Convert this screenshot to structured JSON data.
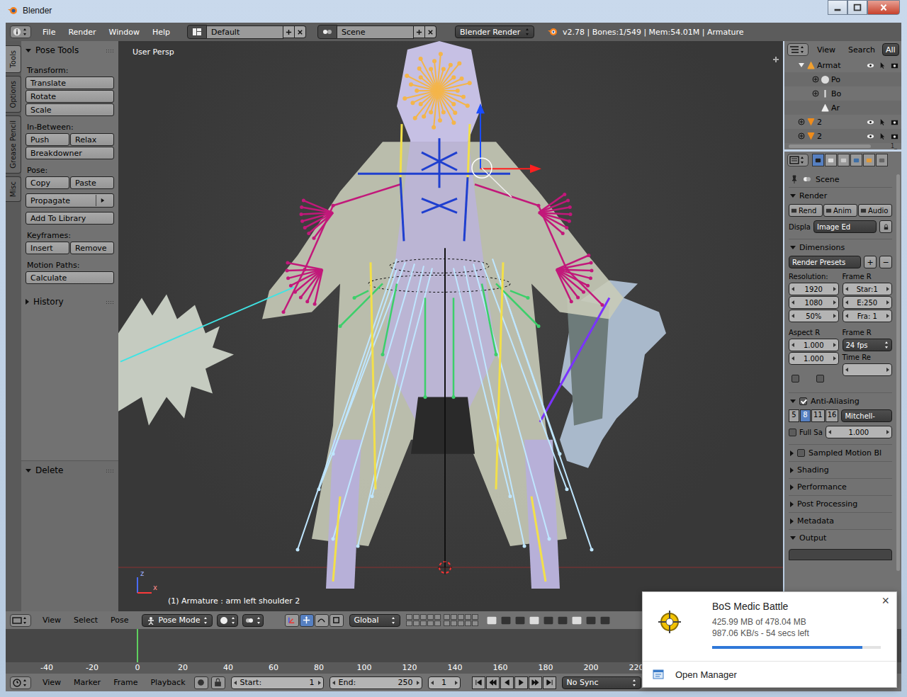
{
  "window": {
    "title": "Blender"
  },
  "info_header": {
    "menus": [
      "File",
      "Render",
      "Window",
      "Help"
    ],
    "layout": "Default",
    "scene": "Scene",
    "engine": "Blender Render",
    "stats": "v2.78 | Bones:1/549 | Mem:54.01M | Armature"
  },
  "tool_shelf": {
    "tabs": [
      {
        "label": "Tools",
        "selected": true
      },
      {
        "label": "Options",
        "selected": false
      },
      {
        "label": "Grease Pencil",
        "selected": false
      },
      {
        "label": "Misc",
        "selected": false
      }
    ],
    "panel": {
      "title": "Pose Tools",
      "expanded": true,
      "groups": [
        {
          "label": "Transform:",
          "joined": true,
          "rows": [
            [
              {
                "label": "Translate",
                "kind": "button"
              }
            ],
            [
              {
                "label": "Rotate",
                "kind": "button"
              }
            ],
            [
              {
                "label": "Scale",
                "kind": "button"
              }
            ]
          ]
        },
        {
          "label": "In-Between:",
          "joined": true,
          "rows": [
            [
              {
                "label": "Push",
                "kind": "button"
              },
              {
                "label": "Relax",
                "kind": "button"
              }
            ],
            [
              {
                "label": "Breakdowner",
                "kind": "button"
              }
            ]
          ]
        },
        {
          "label": "Pose:",
          "joined": false,
          "rows": [
            [
              {
                "label": "Copy",
                "kind": "button"
              },
              {
                "label": "Paste",
                "kind": "button"
              }
            ],
            [
              {
                "label": "Propagate",
                "kind": "menu"
              }
            ],
            [
              {
                "label": "Add To Library",
                "kind": "button"
              }
            ]
          ]
        },
        {
          "label": "Keyframes:",
          "joined": true,
          "rows": [
            [
              {
                "label": "Insert",
                "kind": "button"
              },
              {
                "label": "Remove",
                "kind": "button"
              }
            ]
          ]
        },
        {
          "label": "Motion Paths:",
          "joined": true,
          "rows": [
            [
              {
                "label": "Calculate",
                "kind": "button"
              }
            ]
          ]
        }
      ]
    },
    "history": {
      "title": "History",
      "expanded": false
    },
    "operator_panel": {
      "title": "Delete",
      "expanded": true
    }
  },
  "viewport": {
    "view_label": "User Persp",
    "status": "(1) Armature : arm left shoulder 2",
    "axes": [
      "z",
      "x"
    ]
  },
  "viewport_header": {
    "menus": [
      "View",
      "Select",
      "Pose"
    ],
    "mode": "Pose Mode",
    "orientation": "Global",
    "manipulators": [
      {
        "selected": false
      },
      {
        "selected": true
      },
      {
        "selected": false
      },
      {
        "selected": false
      }
    ]
  },
  "outliner": {
    "menus": [
      "View",
      "Search"
    ],
    "filter": "All",
    "corner_text": "1_",
    "rows": [
      {
        "label": "Armat",
        "depth": 0,
        "kind": "armature",
        "toggle": true,
        "expanded": true
      },
      {
        "label": "Po",
        "depth": 1,
        "kind": "pose",
        "toggle": true,
        "expanded": false
      },
      {
        "label": "Bo",
        "depth": 1,
        "kind": "bones",
        "toggle": true,
        "expanded": false
      },
      {
        "label": "Ar",
        "depth": 1,
        "kind": "data",
        "toggle": false,
        "expanded": false
      },
      {
        "label": "2",
        "depth": 0,
        "kind": "mesh",
        "toggle": true,
        "expanded": false
      },
      {
        "label": "2",
        "depth": 0,
        "kind": "mesh",
        "toggle": true,
        "expanded": false
      }
    ]
  },
  "properties": {
    "tabs": [
      {
        "selected": true
      },
      {
        "selected": false
      },
      {
        "selected": false
      },
      {
        "selected": false
      },
      {
        "selected": false
      },
      {
        "selected": false
      }
    ],
    "context": "Scene",
    "render": {
      "title": "Render",
      "expanded": true,
      "buttons": [
        "Rend",
        "Anim",
        "Audio"
      ],
      "display_label": "Displa",
      "display": "Image Ed"
    },
    "dimensions": {
      "title": "Dimensions",
      "expanded": true,
      "presets": "Render Presets",
      "preset_add": "+",
      "preset_remove": "−",
      "resolution_label": "Resolution:",
      "resolution": [
        "1920",
        "1080",
        "50%"
      ],
      "frame_range_label": "Frame R",
      "frame_range": [
        "Star:1",
        "E:250",
        "Fra: 1"
      ],
      "aspect_label": "Aspect R",
      "aspect": [
        "1.000",
        "1.000"
      ],
      "frame_rate_label": "Frame R",
      "frame_rate": "24 fps",
      "time_remap_label": "Time Re",
      "border": false,
      "crop": false
    },
    "anti_aliasing": {
      "title": "Anti-Aliasing",
      "enabled": true,
      "expanded": true,
      "samples": [
        {
          "label": "5",
          "selected": false
        },
        {
          "label": "8",
          "selected": true
        },
        {
          "label": "11",
          "selected": false
        },
        {
          "label": "16",
          "selected": false
        }
      ],
      "filter": "Mitchell-",
      "full_sample_label": "Full Sa",
      "full_sample": false,
      "filter_size": "1.000"
    },
    "collapsed": [
      {
        "title": "Sampled Motion Bl",
        "kind": "checkbox",
        "checked": false,
        "expanded": false
      },
      {
        "title": "Shading",
        "kind": "plain",
        "checked": false,
        "expanded": false
      },
      {
        "title": "Performance",
        "kind": "plain",
        "checked": false,
        "expanded": false
      },
      {
        "title": "Post Processing",
        "kind": "plain",
        "checked": false,
        "expanded": false
      },
      {
        "title": "Metadata",
        "kind": "plain",
        "checked": false,
        "expanded": false
      },
      {
        "title": "Output",
        "kind": "plain",
        "checked": false,
        "expanded": true
      }
    ]
  },
  "timeline": {
    "ticks": [
      {
        "label": "-40",
        "current": false
      },
      {
        "label": "-20",
        "current": false
      },
      {
        "label": "0",
        "current": true
      },
      {
        "label": "20",
        "current": false
      },
      {
        "label": "40",
        "current": false
      },
      {
        "label": "60",
        "current": false
      },
      {
        "label": "80",
        "current": false
      },
      {
        "label": "100",
        "current": false
      },
      {
        "label": "120",
        "current": false
      },
      {
        "label": "140",
        "current": false
      },
      {
        "label": "160",
        "current": false
      },
      {
        "label": "180",
        "current": false
      },
      {
        "label": "200",
        "current": false
      },
      {
        "label": "220",
        "current": false
      }
    ]
  },
  "timeline_header": {
    "menus": [
      "View",
      "Marker",
      "Frame",
      "Playback"
    ],
    "start_label": "Start:",
    "start": "1",
    "end_label": "End:",
    "end": "250",
    "frame": "1",
    "sync": "No Sync"
  },
  "download": {
    "title": "BoS Medic Battle",
    "size": "425.99 MB of 478.04 MB",
    "speed": "987.06 KB/s - 54 secs left",
    "level": 0.89,
    "action": "Open Manager",
    "close": "×"
  }
}
